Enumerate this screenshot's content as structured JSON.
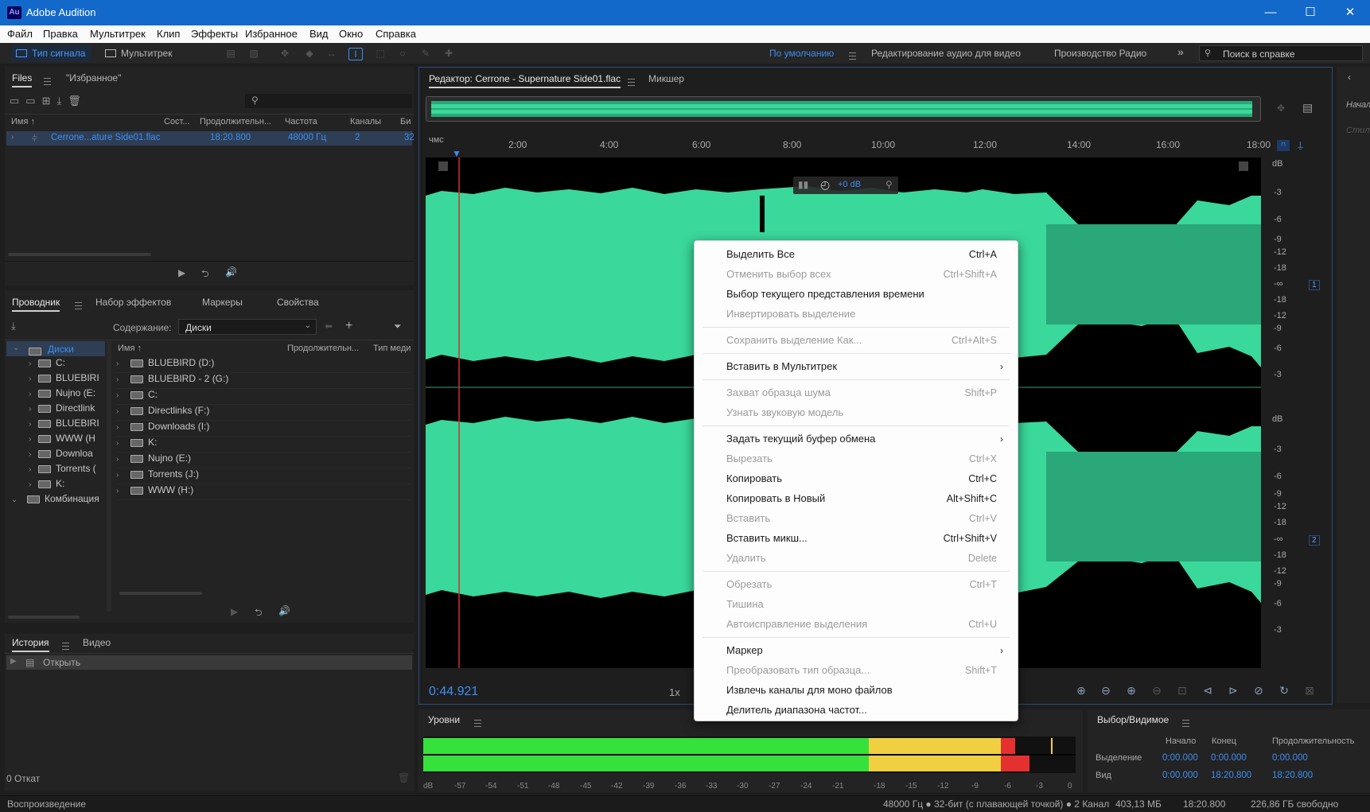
{
  "app": {
    "title": "Adobe Audition",
    "badge": "Au"
  },
  "window_controls": {
    "minimize": "—",
    "maximize": "☐",
    "close": "✕"
  },
  "menu": [
    "Файл",
    "Правка",
    "Мультитрек",
    "Клип",
    "Эффекты",
    "Избранное",
    "Вид",
    "Окно",
    "Справка"
  ],
  "toolbar": {
    "waveform_tab": "Тип сигнала",
    "multitrack_tab": "Мультитрек",
    "workspaces": [
      "По умолчанию",
      "Редактирование аудио для видео",
      "Производство Радио"
    ],
    "more": "»",
    "help_search_placeholder": "Поиск в справке"
  },
  "files_panel": {
    "tabs": [
      "Files",
      "\"Избранное\""
    ],
    "columns": [
      "Имя ↑",
      "Сост...",
      "Продолжительн...",
      "Частота",
      "Каналы",
      "Би"
    ],
    "rows": [
      {
        "name": "Cerrone...ature Side01.flac",
        "duration": "18:20.800",
        "rate": "48000 Гц",
        "channels": "2",
        "bits": "32"
      }
    ]
  },
  "explorer_panel": {
    "tabs": [
      "Проводник",
      "Набор эффектов",
      "Маркеры",
      "Свойства"
    ],
    "content_label": "Содержание:",
    "content_value": "Диски",
    "tree_root": "Диски",
    "tree_items": [
      "C:",
      "BLUEBIRI",
      "Nujno (E:",
      "Directlink",
      "BLUEBIRI",
      "WWW (H",
      "Downloa",
      "Torrents (",
      "K:"
    ],
    "tree_other": "Комбинация",
    "list_columns": [
      "Имя ↑",
      "Продолжительн...",
      "Тип меди"
    ],
    "list_items": [
      "BLUEBIRD (D:)",
      "BLUEBIRD - 2 (G:)",
      "C:",
      "Directlinks (F:)",
      "Downloads (I:)",
      "K:",
      "Nujno (E:)",
      "Torrents (J:)",
      "WWW (H:)"
    ]
  },
  "history_panel": {
    "tabs": [
      "История",
      "Видео"
    ],
    "items": [
      "Открыть"
    ],
    "undo_count": "0 Откат"
  },
  "editor": {
    "tab_title": "Редактор: Cerrone - Supernature Side01.flac",
    "mixer_tab": "Микшер",
    "time_format": "чмс",
    "ruler": [
      "2:00",
      "4:00",
      "6:00",
      "8:00",
      "10:00",
      "12:00",
      "14:00",
      "16:00",
      "18:00"
    ],
    "hud_gain": "+0 dB",
    "db_unit": "dB",
    "db_scale": [
      "-3",
      "-6",
      "-9",
      "-12",
      "-18",
      "-∞",
      "-18",
      "-12",
      "-9",
      "-6",
      "-3"
    ],
    "channel_1": "1",
    "channel_2": "2",
    "current_time": "0:44.921",
    "speed": "1x",
    "right_cut_labels": [
      "Начало",
      "Стил"
    ]
  },
  "context_menu": {
    "items": [
      {
        "label": "Выделить Все",
        "shortcut": "Ctrl+A",
        "disabled": false
      },
      {
        "label": "Отменить выбор всех",
        "shortcut": "Ctrl+Shift+A",
        "disabled": true
      },
      {
        "label": "Выбор текущего представления времени",
        "shortcut": "",
        "disabled": false
      },
      {
        "label": "Инвертировать выделение",
        "shortcut": "",
        "disabled": true
      },
      {
        "label": "Сохранить выделение Как...",
        "shortcut": "Ctrl+Alt+S",
        "disabled": true
      },
      {
        "label": "Вставить в Мультитрек",
        "shortcut": "",
        "disabled": false,
        "submenu": true
      },
      {
        "label": "Захват образца шума",
        "shortcut": "Shift+P",
        "disabled": true
      },
      {
        "label": "Узнать звуковую модель",
        "shortcut": "",
        "disabled": true
      },
      {
        "label": "Задать текущий буфер обмена",
        "shortcut": "",
        "disabled": false,
        "submenu": true
      },
      {
        "label": "Вырезать",
        "shortcut": "Ctrl+X",
        "disabled": true
      },
      {
        "label": "Копировать",
        "shortcut": "Ctrl+C",
        "disabled": false
      },
      {
        "label": "Копировать в Новый",
        "shortcut": "Alt+Shift+C",
        "disabled": false
      },
      {
        "label": "Вставить",
        "shortcut": "Ctrl+V",
        "disabled": true
      },
      {
        "label": "Вставить микш...",
        "shortcut": "Ctrl+Shift+V",
        "disabled": false
      },
      {
        "label": "Удалить",
        "shortcut": "Delete",
        "disabled": true
      },
      {
        "label": "Обрезать",
        "shortcut": "Ctrl+T",
        "disabled": true
      },
      {
        "label": "Тишина",
        "shortcut": "",
        "disabled": true
      },
      {
        "label": "Автоисправление выделения",
        "shortcut": "Ctrl+U",
        "disabled": true
      },
      {
        "label": "Маркер",
        "shortcut": "",
        "disabled": false,
        "submenu": true
      },
      {
        "label": "Преобразовать тип образца...",
        "shortcut": "Shift+T",
        "disabled": true
      },
      {
        "label": "Извлечь каналы для моно файлов",
        "shortcut": "",
        "disabled": false
      },
      {
        "label": "Делитель диапазона частот...",
        "shortcut": "",
        "disabled": false
      }
    ],
    "submenu_arrow": "›"
  },
  "levels_panel": {
    "title": "Уровни",
    "scale": [
      "dB",
      "-57",
      "-54",
      "-51",
      "-48",
      "-45",
      "-42",
      "-39",
      "-36",
      "-33",
      "-30",
      "-27",
      "-24",
      "-21",
      "-18",
      "-15",
      "-12",
      "-9",
      "-6",
      "-3",
      "0"
    ],
    "peak_left": 0.92,
    "peak_right": 0.91
  },
  "selection_panel": {
    "title": "Выбор/Видимое",
    "columns": [
      "Начало",
      "Конец",
      "Продолжительность"
    ],
    "rows": [
      {
        "label": "Выделение",
        "start": "0:00.000",
        "end": "0:00.000",
        "duration": "0:00.000"
      },
      {
        "label": "Вид",
        "start": "0:00.000",
        "end": "18:20.800",
        "duration": "18:20.800"
      }
    ]
  },
  "status_bar": {
    "left": "Воспроизведение",
    "format": "48000 Гц ● 32-бит (с плавающей точкой) ● 2 Канал",
    "size": "403,13 МБ",
    "duration": "18:20.800",
    "free": "226,86 ГБ свободно"
  },
  "colors": {
    "accent": "#1369c9",
    "waveform": "#3ad89a",
    "waveform_dim": "#2aa879",
    "playhead": "#d03030",
    "link": "#3d8ef0"
  }
}
